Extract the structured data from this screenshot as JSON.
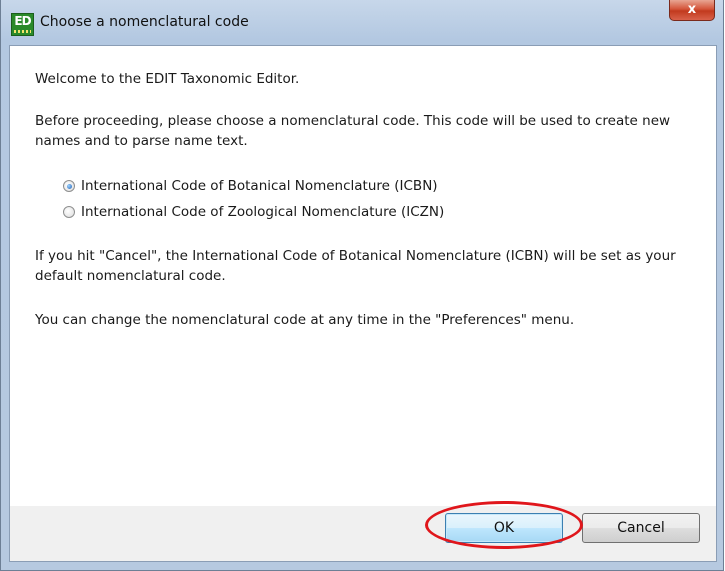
{
  "window": {
    "title": "Choose a nomenclatural code",
    "icon_text": "ED",
    "close_glyph": "x"
  },
  "dialog": {
    "welcome": "Welcome to the EDIT Taxonomic Editor.",
    "intro": "Before proceeding, please choose a nomenclatural code. This code will be used to create new names and to parse name text.",
    "options": [
      {
        "label": "International Code of Botanical Nomenclature (ICBN)",
        "selected": true
      },
      {
        "label": "International Code of Zoological Nomenclature (ICZN)",
        "selected": false
      }
    ],
    "cancel_note": "If you hit \"Cancel\",  the International Code of Botanical Nomenclature (ICBN) will be set as your default nomenclatural code.",
    "preferences_note": "You can change the nomenclatural code at any time in the \"Preferences\" menu."
  },
  "buttons": {
    "ok_label": "OK",
    "cancel_label": "Cancel"
  },
  "annotation": {
    "highlight_color": "#e0161b"
  }
}
